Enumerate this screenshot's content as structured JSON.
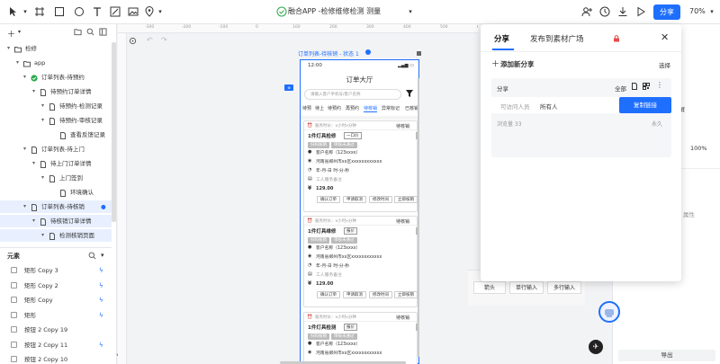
{
  "toolbar": {
    "title": "融合APP -检修维修检测 测量",
    "share_label": "分享",
    "zoom": "70%"
  },
  "left_panel": {
    "tree": [
      {
        "label": "检修",
        "level": 0,
        "icon": "folder-icon"
      },
      {
        "label": "app",
        "level": 1,
        "icon": "folder-icon"
      },
      {
        "label": "订单列表-待预约",
        "level": 2,
        "icon": "check-circle-icon"
      },
      {
        "label": "待预约订单详情",
        "level": 3,
        "icon": "page-icon"
      },
      {
        "label": "待预约-检测记录",
        "level": 4,
        "icon": "page-icon"
      },
      {
        "label": "待预约-审核记录",
        "level": 4,
        "icon": "page-icon"
      },
      {
        "label": "查看反馈记录",
        "level": 5,
        "icon": "page-icon"
      },
      {
        "label": "订单列表-待上门",
        "level": 2,
        "icon": "page-icon"
      },
      {
        "label": "待上门订单详情",
        "level": 3,
        "icon": "page-icon"
      },
      {
        "label": "上门签到",
        "level": 4,
        "icon": "page-icon"
      },
      {
        "label": "环境确认",
        "level": 5,
        "icon": "page-icon"
      },
      {
        "label": "订单列表-待核销",
        "level": 2,
        "icon": "page-icon",
        "selected": true
      },
      {
        "label": "待核销订单详情",
        "level": 3,
        "icon": "page-icon",
        "selected": true
      },
      {
        "label": "检测核销页面",
        "level": 4,
        "icon": "page-icon",
        "selected": true
      }
    ],
    "elements_title": "元素",
    "elements": [
      {
        "label": "矩形 Copy 3"
      },
      {
        "label": "矩形 Copy 2"
      },
      {
        "label": "矩形 Copy"
      },
      {
        "label": "矩形"
      },
      {
        "label": "按钮 2 Copy 19"
      },
      {
        "label": "按钮 2 Copy 11"
      },
      {
        "label": "按钮 2 Copy 10"
      }
    ]
  },
  "canvas": {
    "ruler_labels": [
      "-300",
      "-200",
      "-100",
      "0",
      "100",
      "200",
      "300",
      "400",
      "500",
      "600"
    ],
    "frame_label": "订单列表-待核销 - 状态 1",
    "phone": {
      "time": "12:00",
      "page_title": "订单大厅",
      "search_placeholder": "请输入客户手机号/客户名称",
      "tabs": [
        "待预",
        "待上",
        "待预约",
        "再预约",
        "待核销",
        "异常标记",
        "已核销"
      ],
      "cards": [
        {
          "time_label": "服务时长：x小时x分钟",
          "status": "待核销",
          "title": "1件灯具检修",
          "tag": "一口价",
          "chips": [
            "扫码核销",
            "审核未通过"
          ],
          "customer": "客户名称（123xxxx）",
          "address": "河南省郑州市xx区xxxxxxxxxxxx",
          "date": "年-月-日 时-分-秒",
          "note": "工人服务备注",
          "price": "129.00",
          "buttons": [
            "确认订单",
            "申请取消",
            "修改时间",
            "立即核销"
          ]
        },
        {
          "time_label": "服务时长：x小时x分钟",
          "status": "待核销",
          "title": "1件灯具维修",
          "tag": "报价",
          "chips": [
            "扫码核销",
            "审核未通过"
          ],
          "customer": "客户名称（123xxxx）",
          "address": "河南省郑州市xx区xxxxxxxxxxxx",
          "date": "年-月-日 时-分-秒",
          "note": "工人服务备注",
          "price": "129.00",
          "buttons": [
            "确认订单",
            "申请取消",
            "修改时间",
            "立即核销"
          ]
        },
        {
          "time_label": "服务时长：x小时x分钟",
          "status": "待核销",
          "title": "1件灯具检测",
          "tag": "报价",
          "chips": [
            "扫码核销",
            "审核未通过"
          ],
          "customer": "客户名称（123xxxx）",
          "address": "河南省郑州市xx区xxxxxxxxxxxx"
        }
      ]
    },
    "components": [
      "箭头",
      "单行输入",
      "多行输入"
    ]
  },
  "share_popup": {
    "tab_share": "分享",
    "tab_market": "发布到素材广场",
    "add_label": "添加新分享",
    "select_label": "选择",
    "section_label": "分享",
    "scope_label": "全部",
    "access_placeholder": "可访问人员",
    "access_value": "所有人",
    "copy_button": "复制链接",
    "views": "浏览量 33",
    "validity": "永久"
  },
  "right_panel": {
    "checkbox_label": "横屏",
    "zoom_value": "100%",
    "prop_label": "属性",
    "export_label": "导出"
  },
  "colors": {
    "accent": "#1f6fff",
    "selected_bg": "#e8f0ff"
  }
}
